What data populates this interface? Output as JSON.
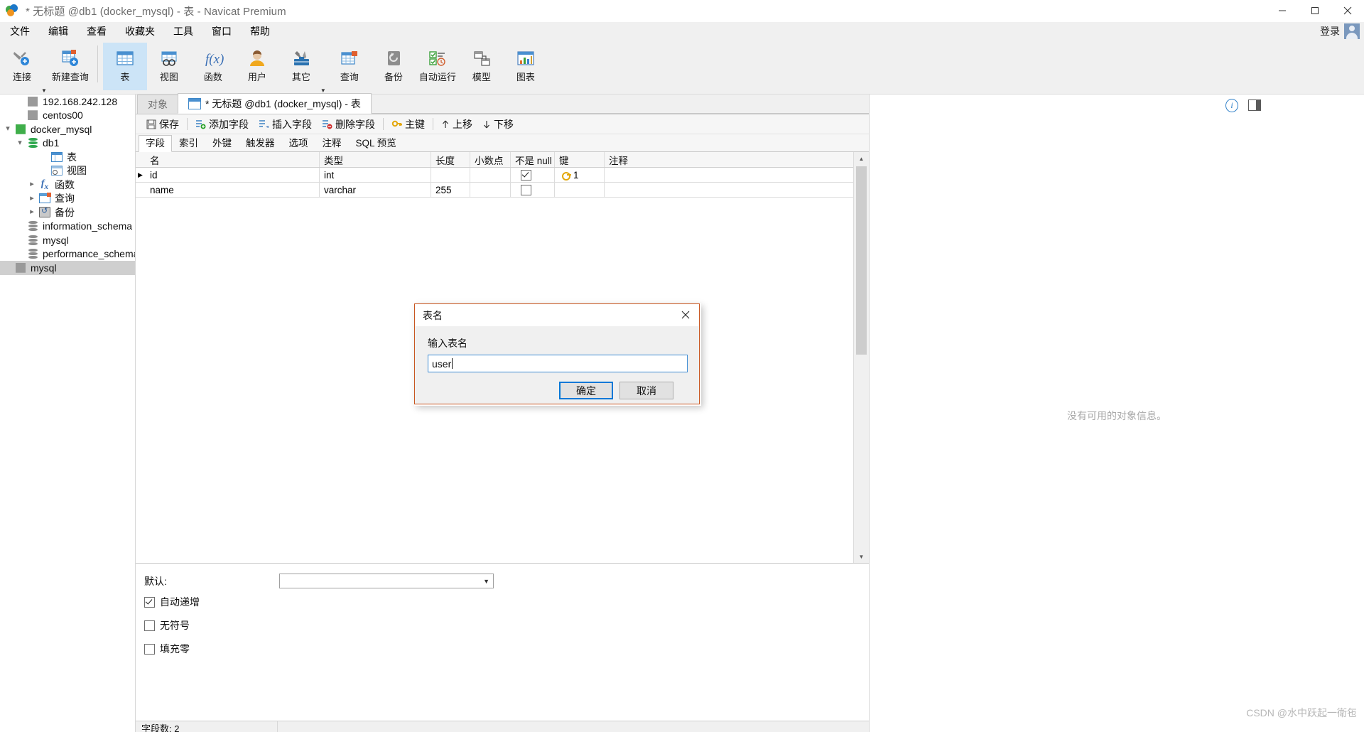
{
  "window": {
    "title": "* 无标题 @db1 (docker_mysql) - 表 - Navicat Premium",
    "minimize": "─",
    "maximize": "□",
    "close": "✕"
  },
  "menubar": {
    "items": [
      "文件",
      "编辑",
      "查看",
      "收藏夹",
      "工具",
      "窗口",
      "帮助"
    ],
    "login_label": "登录"
  },
  "ribbon": {
    "buttons": [
      {
        "label": "连接",
        "icon": "connection-icon",
        "caret": true
      },
      {
        "label": "新建查询",
        "icon": "new-query-icon",
        "caret": false
      },
      {
        "label": "表",
        "icon": "table-icon",
        "active": true
      },
      {
        "label": "视图",
        "icon": "view-icon",
        "active": false
      },
      {
        "label": "函数",
        "icon": "function-icon",
        "active": false
      },
      {
        "label": "用户",
        "icon": "user-icon",
        "active": false
      },
      {
        "label": "其它",
        "icon": "other-tools-icon",
        "caret": true
      },
      {
        "label": "查询",
        "icon": "query-icon",
        "active": false
      },
      {
        "label": "备份",
        "icon": "backup-icon",
        "active": false
      },
      {
        "label": "自动运行",
        "icon": "automation-icon",
        "active": false
      },
      {
        "label": "模型",
        "icon": "model-icon",
        "active": false
      },
      {
        "label": "图表",
        "icon": "chart-icon",
        "active": false
      }
    ]
  },
  "sidebar": {
    "items": [
      {
        "label": "192.168.242.128",
        "icon": "connection-icon",
        "indent": 1,
        "twisty": "",
        "selected": false
      },
      {
        "label": "centos00",
        "icon": "connection-icon",
        "indent": 1,
        "twisty": "",
        "selected": false
      },
      {
        "label": "docker_mysql",
        "icon": "connection-green-icon",
        "indent": 0,
        "twisty": "down",
        "selected": false
      },
      {
        "label": "db1",
        "icon": "database-icon",
        "indent": 1,
        "twisty": "down",
        "selected": false
      },
      {
        "label": "表",
        "icon": "table-icon",
        "indent": 3,
        "twisty": "",
        "selected": false
      },
      {
        "label": "视图",
        "icon": "view-icon",
        "indent": 3,
        "twisty": "",
        "selected": false
      },
      {
        "label": "函数",
        "icon": "function-icon",
        "indent": 2,
        "twisty": "right",
        "selected": false
      },
      {
        "label": "查询",
        "icon": "query-icon",
        "indent": 2,
        "twisty": "right",
        "selected": false
      },
      {
        "label": "备份",
        "icon": "backup-icon",
        "indent": 2,
        "twisty": "right",
        "selected": false
      },
      {
        "label": "information_schema",
        "icon": "database-gray-icon",
        "indent": 1,
        "twisty": "",
        "selected": false
      },
      {
        "label": "mysql",
        "icon": "database-gray-icon",
        "indent": 1,
        "twisty": "",
        "selected": false
      },
      {
        "label": "performance_schema",
        "icon": "database-gray-icon",
        "indent": 1,
        "twisty": "",
        "selected": false
      },
      {
        "label": "mysql",
        "icon": "connection-icon",
        "indent": 0,
        "twisty": "",
        "selected": true
      }
    ]
  },
  "editor": {
    "tabs": [
      {
        "label": "对象",
        "active": false,
        "has_icon": false
      },
      {
        "label": "* 无标题 @db1 (docker_mysql) - 表",
        "active": true,
        "has_icon": true
      }
    ],
    "actions": [
      {
        "label": "保存",
        "icon": "save-icon"
      },
      {
        "label": "添加字段",
        "icon": "add-field-icon"
      },
      {
        "label": "插入字段",
        "icon": "insert-field-icon"
      },
      {
        "label": "删除字段",
        "icon": "delete-field-icon"
      },
      {
        "label": "主键",
        "icon": "primary-key-icon"
      },
      {
        "label": "上移",
        "icon": "move-up-icon"
      },
      {
        "label": "下移",
        "icon": "move-down-icon"
      }
    ],
    "subtabs": [
      {
        "label": "字段",
        "active": true
      },
      {
        "label": "索引",
        "active": false
      },
      {
        "label": "外键",
        "active": false
      },
      {
        "label": "触发器",
        "active": false
      },
      {
        "label": "选项",
        "active": false
      },
      {
        "label": "注释",
        "active": false
      },
      {
        "label": "SQL 预览",
        "active": false
      }
    ],
    "grid": {
      "columns": [
        "名",
        "类型",
        "长度",
        "小数点",
        "不是 null",
        "键",
        "注释"
      ],
      "rows": [
        {
          "marker": "▶",
          "name": "id",
          "type": "int",
          "length": "",
          "decimals": "",
          "not_null": true,
          "key": "1",
          "comment": ""
        },
        {
          "marker": "",
          "name": "name",
          "type": "varchar",
          "length": "255",
          "decimals": "",
          "not_null": false,
          "key": "",
          "comment": ""
        }
      ]
    },
    "properties": {
      "default_label": "默认:",
      "default_value": "",
      "checkboxes": [
        {
          "label": "自动递增",
          "checked": true
        },
        {
          "label": "无符号",
          "checked": false
        },
        {
          "label": "填充零",
          "checked": false
        }
      ]
    },
    "statusbar": {
      "field_count": "字段数: 2"
    }
  },
  "right_panel": {
    "empty_message": "没有可用的对象信息。",
    "info_icon": "info-icon",
    "panel_icon": "toggle-panel-icon"
  },
  "watermark": "CSDN @水中跃起一衛㐌",
  "dialog": {
    "title": "表名",
    "close": "✕",
    "field_label": "输入表名",
    "input_value": "user",
    "ok_label": "确定",
    "cancel_label": "取消"
  }
}
